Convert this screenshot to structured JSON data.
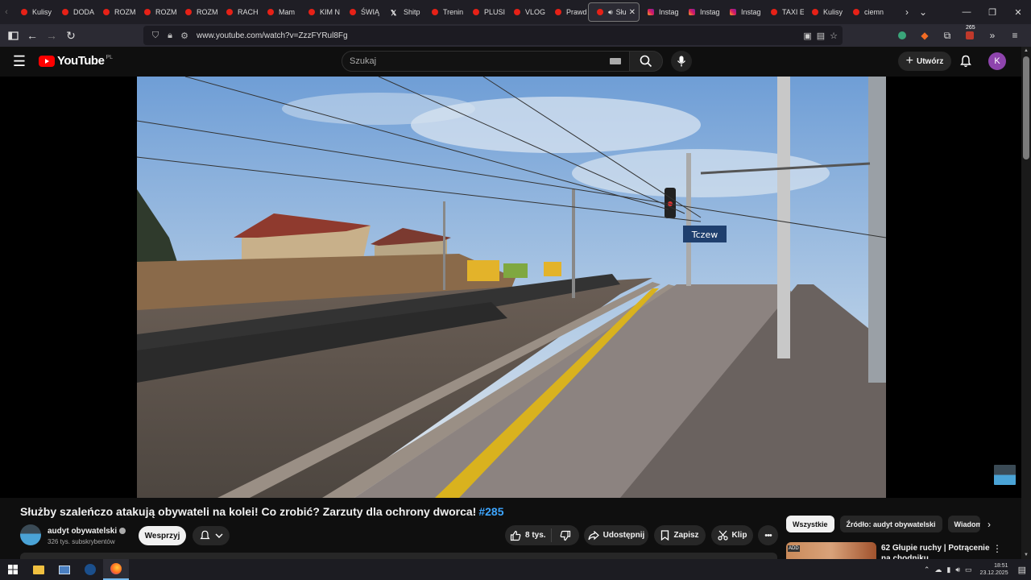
{
  "browser": {
    "tabs": [
      {
        "label": "Kulisy",
        "icon": "youtube-favicon-icon"
      },
      {
        "label": "DODA",
        "icon": "youtube-favicon-icon"
      },
      {
        "label": "ROZM",
        "icon": "youtube-favicon-icon"
      },
      {
        "label": "ROZM",
        "icon": "youtube-favicon-icon"
      },
      {
        "label": "ROZM",
        "icon": "youtube-favicon-icon"
      },
      {
        "label": "RACH",
        "icon": "youtube-favicon-icon"
      },
      {
        "label": "Mam",
        "icon": "youtube-favicon-icon"
      },
      {
        "label": "KIM N",
        "icon": "youtube-favicon-icon"
      },
      {
        "label": "ŚWIĄ",
        "icon": "youtube-favicon-icon"
      },
      {
        "label": "Shitp",
        "icon": "x-favicon-icon"
      },
      {
        "label": "Trenin",
        "icon": "youtube-favicon-icon"
      },
      {
        "label": "PLUSI",
        "icon": "youtube-favicon-icon"
      },
      {
        "label": "VLOG",
        "icon": "youtube-favicon-icon"
      },
      {
        "label": "Prawd",
        "icon": "youtube-favicon-icon"
      },
      {
        "label": "Słu",
        "icon": "youtube-favicon-icon"
      },
      {
        "label": "Instag",
        "icon": "instagram-favicon-icon"
      },
      {
        "label": "Instag",
        "icon": "instagram-favicon-icon"
      },
      {
        "label": "Instag",
        "icon": "instagram-favicon-icon"
      },
      {
        "label": "TAXI E",
        "icon": "youtube-favicon-icon"
      },
      {
        "label": "Kulisy",
        "icon": "youtube-favicon-icon"
      },
      {
        "label": "ciemn",
        "icon": "youtube-favicon-icon"
      }
    ],
    "url": "www.youtube.com/watch?v=ZzzFYRul8Fg",
    "extensions_badge": "265"
  },
  "youtube": {
    "logo_text": "YouTube",
    "country_code": "PL",
    "search_placeholder": "Szukaj",
    "create_label": "Utwórz",
    "avatar_letter": "K",
    "accent": "#3ea6ff"
  },
  "video": {
    "title": "Służby szaleńczo atakują obywateli na kolei! Co zrobić? Zarzuty dla ochrony dworca!",
    "hashtag": "#285",
    "station_sign": "Tczew",
    "channel_name": "audyt obywatelski",
    "subscribers": "326 tys. subskrybentów",
    "support_label": "Wesprzyj",
    "likes": "8 tys.",
    "share_label": "Udostępnij",
    "save_label": "Zapisz",
    "clip_label": "Klip"
  },
  "sidebar": {
    "chips": [
      "Wszystkie",
      "Źródło: audyt obywatelski",
      "Wiadom"
    ],
    "rec_title": "62 Głupie ruchy | Potrącenie na chodniku"
  },
  "taskbar": {
    "time": "18:51",
    "date": "23.12.2025"
  }
}
